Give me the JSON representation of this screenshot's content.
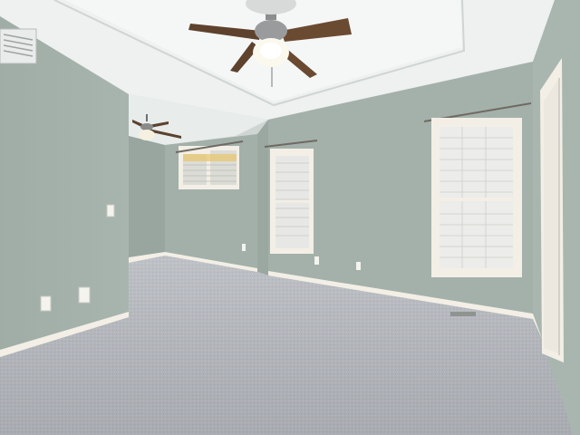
{
  "scene": {
    "room": "empty-bedroom",
    "wall_color": "#a3b0a9",
    "carpet_color": "#b9bcc1",
    "ceiling_color": "#eef1ef",
    "trim_color": "#f5f2ea",
    "fan_blade_color": "#6b4a32"
  }
}
